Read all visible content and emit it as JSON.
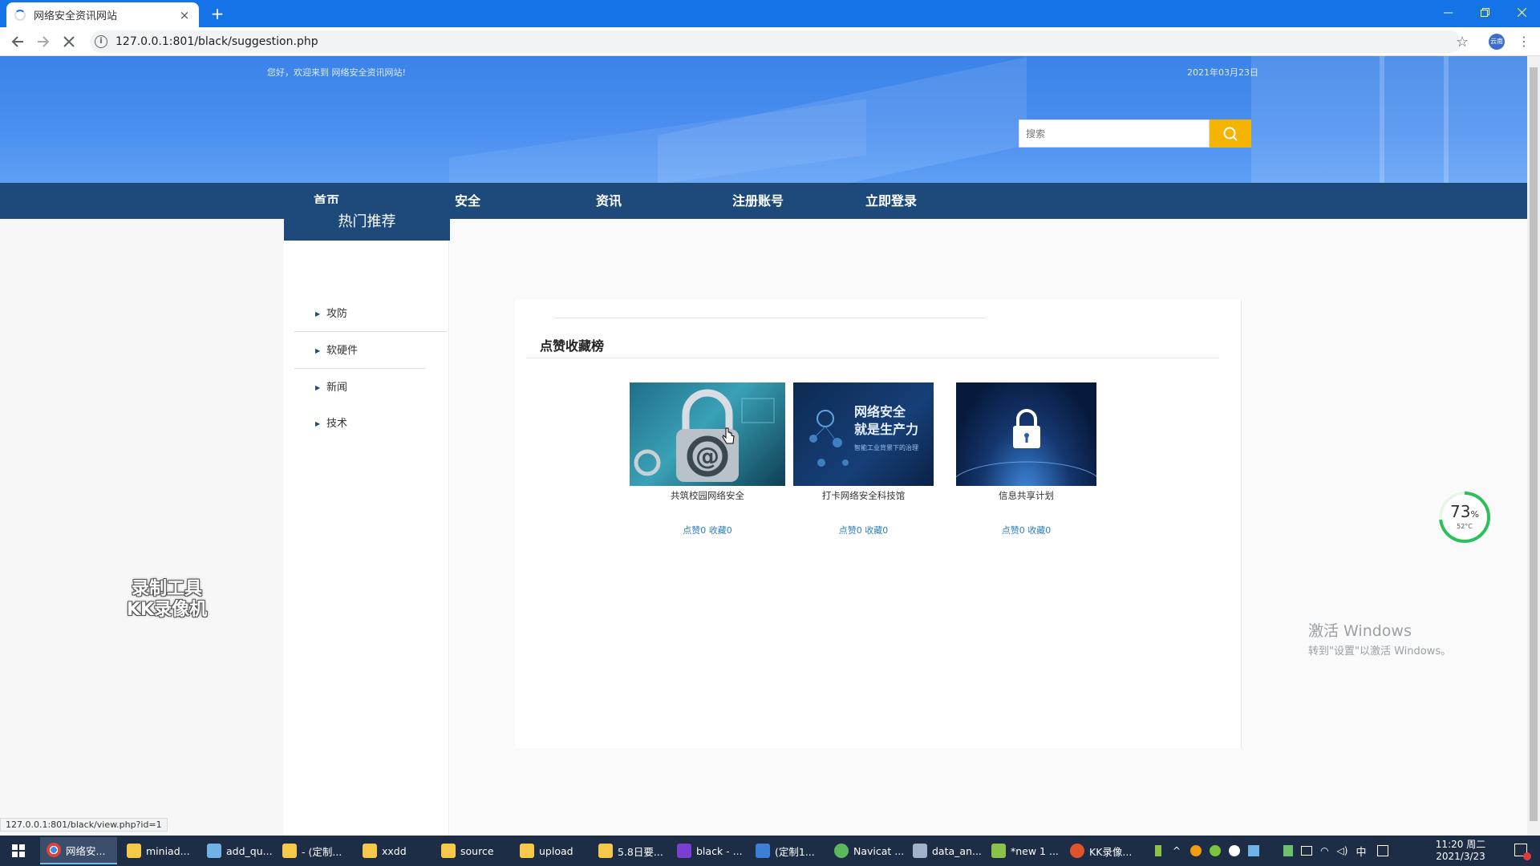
{
  "browser": {
    "tab_title": "网络安全资讯网站",
    "tab_close": "×",
    "new_tab": "+",
    "url": "127.0.0.1:801/black/suggestion.php",
    "status_url": "127.0.0.1:801/black/view.php?id=1",
    "profile_label": "云南"
  },
  "header": {
    "welcome": "您好，欢迎来到 网络安全资讯网站!",
    "date": "2021年03月23日",
    "search_placeholder": "搜索"
  },
  "nav": {
    "items": [
      "首页",
      "安全",
      "资讯",
      "注册账号",
      "立即登录"
    ]
  },
  "sidebar": {
    "title": "热门推荐",
    "items": [
      "攻防",
      "软硬件",
      "新闻",
      "技术"
    ]
  },
  "main": {
    "section_title": "点赞收藏榜",
    "cards": [
      {
        "caption": "共筑校园网络安全",
        "stats": "点赞0 收藏0"
      },
      {
        "caption": "打卡网络安全科技馆",
        "stats": "点赞0 收藏0",
        "image_text_1": "网络安全",
        "image_text_2": "就是生产力",
        "image_text_3": "智能工业背景下的治理"
      },
      {
        "caption": "信息共享计划",
        "stats": "点赞0 收藏0"
      }
    ]
  },
  "overlay": {
    "watermark_line1": "录制工具",
    "watermark_line2": "KK录像机",
    "activate_title": "激活 Windows",
    "activate_sub": "转到\"设置\"以激活 Windows。",
    "gauge_value": "73",
    "gauge_unit": "%",
    "gauge_temp": "52°C"
  },
  "taskbar": {
    "items": [
      "网络安...",
      "miniad...",
      "add_qu...",
      "- (定制...",
      "xxdd",
      "source",
      "upload",
      "5.8日要...",
      "black - ...",
      "(定制1...",
      "Navicat ...",
      "data_an...",
      "*new 1 ...",
      "KK录像..."
    ],
    "ime": "中",
    "time": "11:20 周二",
    "date": "2021/3/23"
  },
  "colors": {
    "nav_bg": "#1d4a7a",
    "banner": "#4b8ff0",
    "search_btn": "#f5b400",
    "stats_link": "#2e7fb8",
    "taskbar": "#1c2d45"
  }
}
